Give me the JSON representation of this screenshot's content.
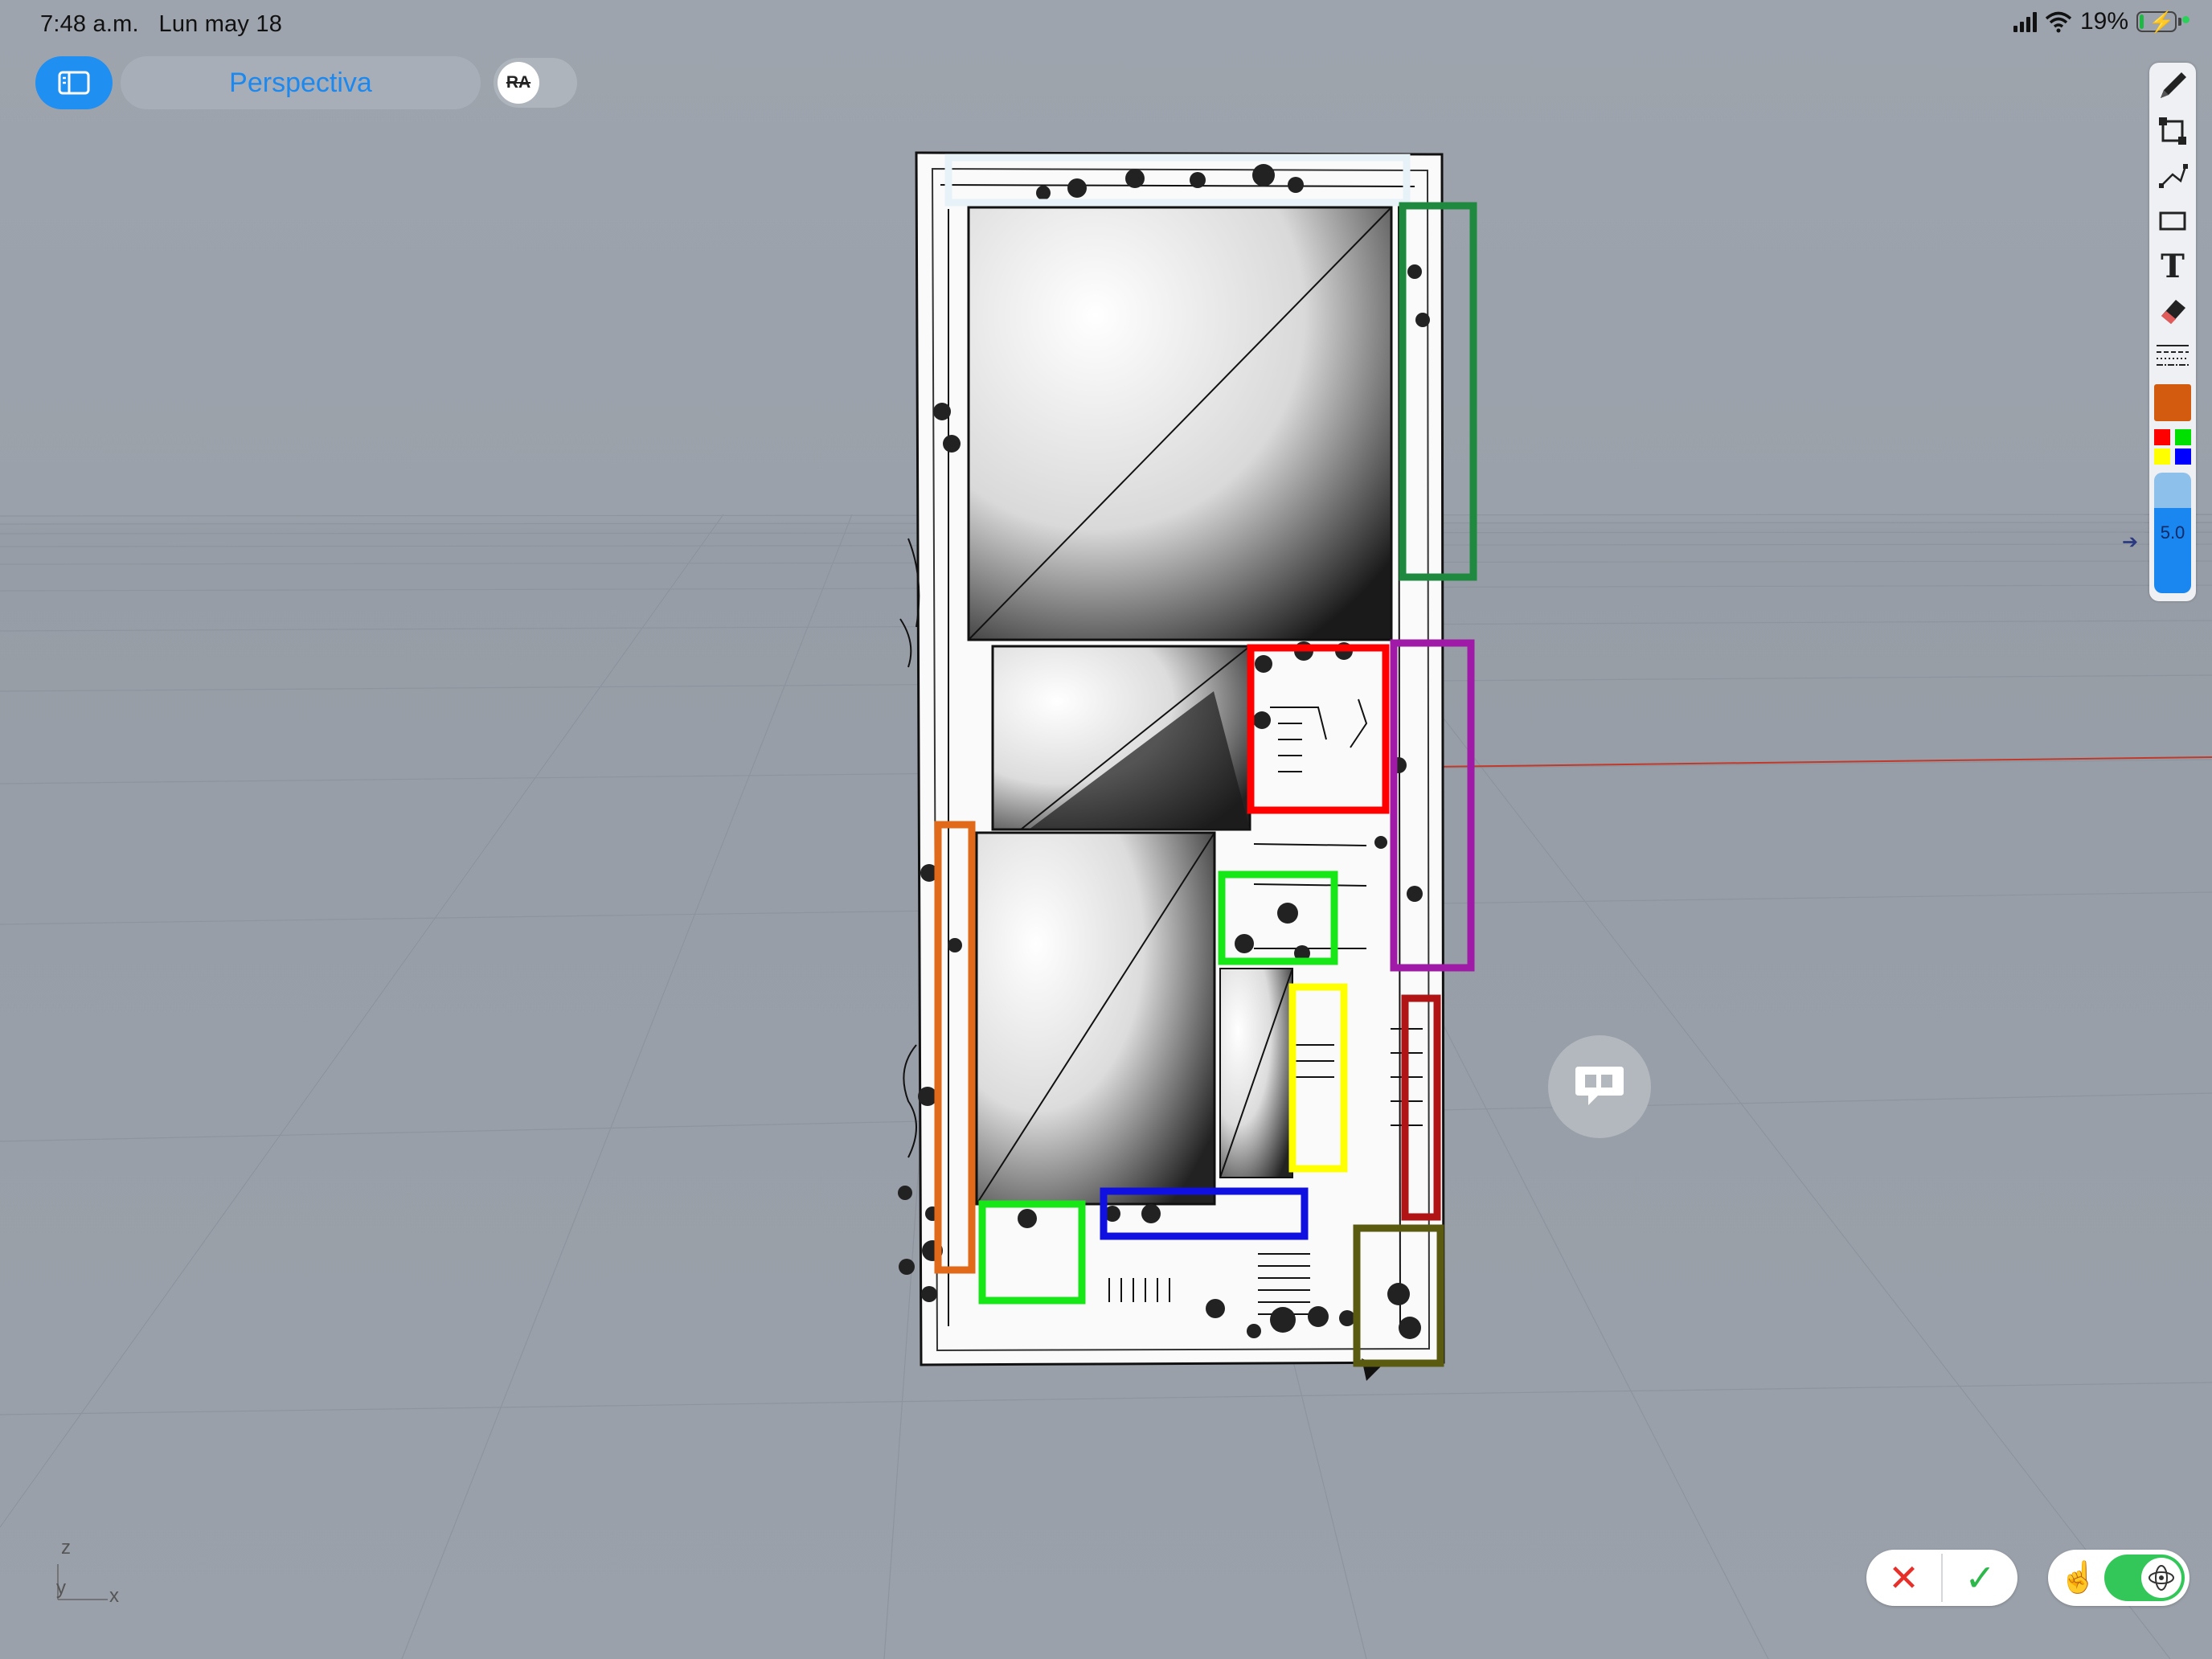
{
  "status_bar": {
    "time": "7:48 a.m.",
    "date": "Lun may 18",
    "battery": "19%",
    "battery_level": 0.19,
    "battery_color": "#1fb845"
  },
  "toolbar": {
    "sidebar_icon": "sidebar-icon",
    "view_name": "Perspectiva",
    "ra_label": "RA"
  },
  "palette": {
    "tools": [
      "pencil-icon",
      "point-edit-icon",
      "polyline-icon",
      "rectangle-icon",
      "text-icon",
      "eraser-icon",
      "line-style-icon"
    ],
    "text_tool_glyph": "T",
    "active_color": "#d35b0f",
    "quick_colors": [
      "#ff0000",
      "#00e000",
      "#ffff00",
      "#0000ff"
    ],
    "thickness_value": "5.0"
  },
  "axis": {
    "z": "z",
    "y": "y",
    "x": "x"
  },
  "bottom": {
    "cancel_glyph": "✕",
    "confirm_glyph": "✓",
    "cancel_color": "#e8302a",
    "confirm_color": "#2eb84b",
    "mode_toggle_on": true
  },
  "highlight_colors": {
    "light_blue": "#e6f2f8",
    "dark_green": "#1f8a3f",
    "red": "#ff0000",
    "purple": "#a01aa8",
    "orange": "#e06a1a",
    "bright_green": "#17e617",
    "yellow": "#ffff00",
    "dark_red": "#b01414",
    "blue": "#1010e0",
    "olive": "#5a5a10"
  }
}
